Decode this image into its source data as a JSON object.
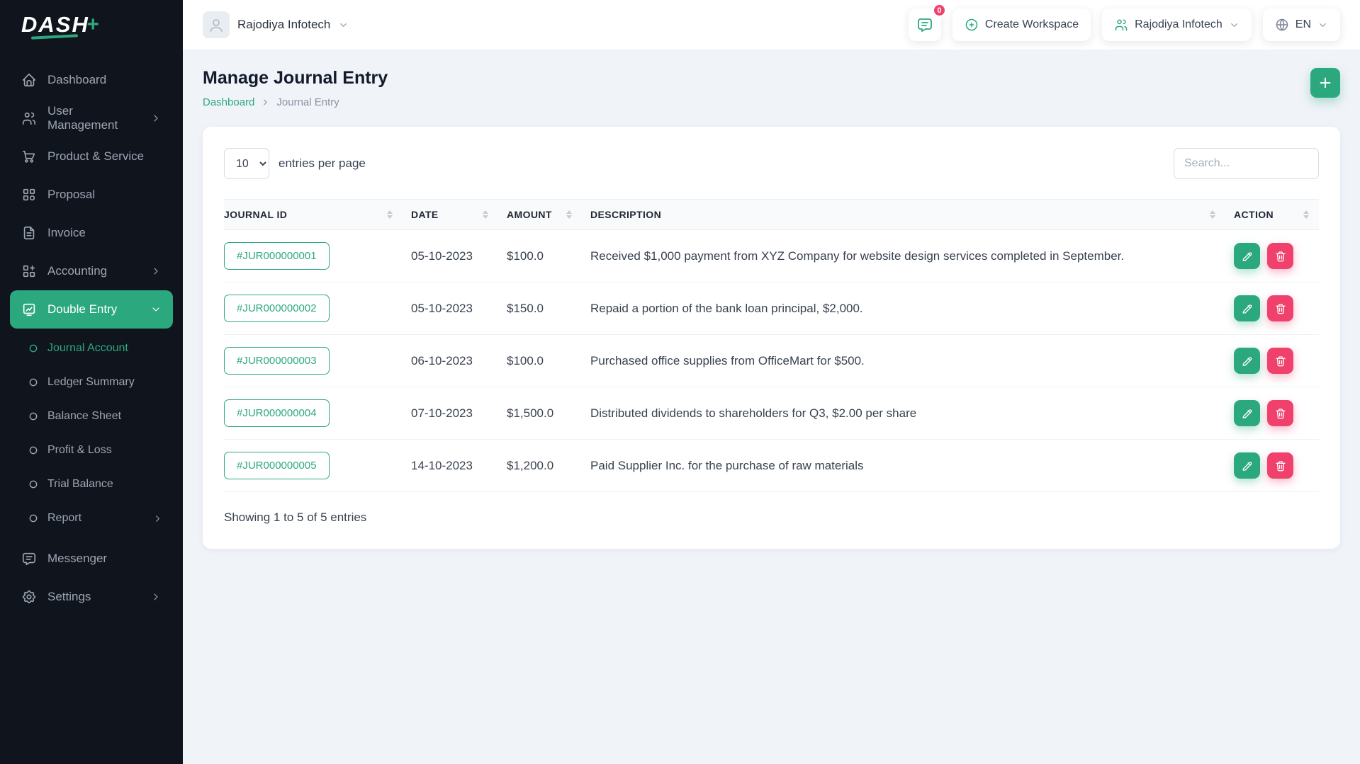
{
  "accent": "#2ca87f",
  "danger": "#f0416c",
  "brand": {
    "logo_text": "DASH"
  },
  "topbar": {
    "workspace": {
      "name": "Rajodiya Infotech"
    },
    "messages_badge": "0",
    "create_workspace_label": "Create Workspace",
    "company_name": "Rajodiya Infotech",
    "language": "EN"
  },
  "sidebar": {
    "items": [
      {
        "label": "Dashboard"
      },
      {
        "label": "User Management"
      },
      {
        "label": "Product & Service"
      },
      {
        "label": "Proposal"
      },
      {
        "label": "Invoice"
      },
      {
        "label": "Accounting"
      },
      {
        "label": "Double Entry"
      },
      {
        "label": "Messenger"
      },
      {
        "label": "Settings"
      }
    ],
    "double_entry_children": [
      {
        "label": "Journal Account"
      },
      {
        "label": "Ledger Summary"
      },
      {
        "label": "Balance Sheet"
      },
      {
        "label": "Profit & Loss"
      },
      {
        "label": "Trial Balance"
      },
      {
        "label": "Report"
      }
    ]
  },
  "page": {
    "title": "Manage Journal Entry",
    "breadcrumb_home": "Dashboard",
    "breadcrumb_current": "Journal Entry"
  },
  "table": {
    "per_page_value": "10",
    "per_page_label": "entries per page",
    "search_placeholder": "Search...",
    "columns": {
      "journal_id": "JOURNAL ID",
      "date": "DATE",
      "amount": "AMOUNT",
      "description": "DESCRIPTION",
      "action": "ACTION"
    },
    "rows": [
      {
        "journal_id": "#JUR000000001",
        "date": "05-10-2023",
        "amount": "$100.0",
        "description": "Received $1,000 payment from XYZ Company for website design services completed in September."
      },
      {
        "journal_id": "#JUR000000002",
        "date": "05-10-2023",
        "amount": "$150.0",
        "description": "Repaid a portion of the bank loan principal, $2,000."
      },
      {
        "journal_id": "#JUR000000003",
        "date": "06-10-2023",
        "amount": "$100.0",
        "description": "Purchased office supplies from OfficeMart for $500."
      },
      {
        "journal_id": "#JUR000000004",
        "date": "07-10-2023",
        "amount": "$1,500.0",
        "description": "Distributed dividends to shareholders for Q3, $2.00 per share"
      },
      {
        "journal_id": "#JUR000000005",
        "date": "14-10-2023",
        "amount": "$1,200.0",
        "description": "Paid Supplier Inc. for the purchase of raw materials"
      }
    ],
    "summary": "Showing 1 to 5 of 5 entries"
  }
}
